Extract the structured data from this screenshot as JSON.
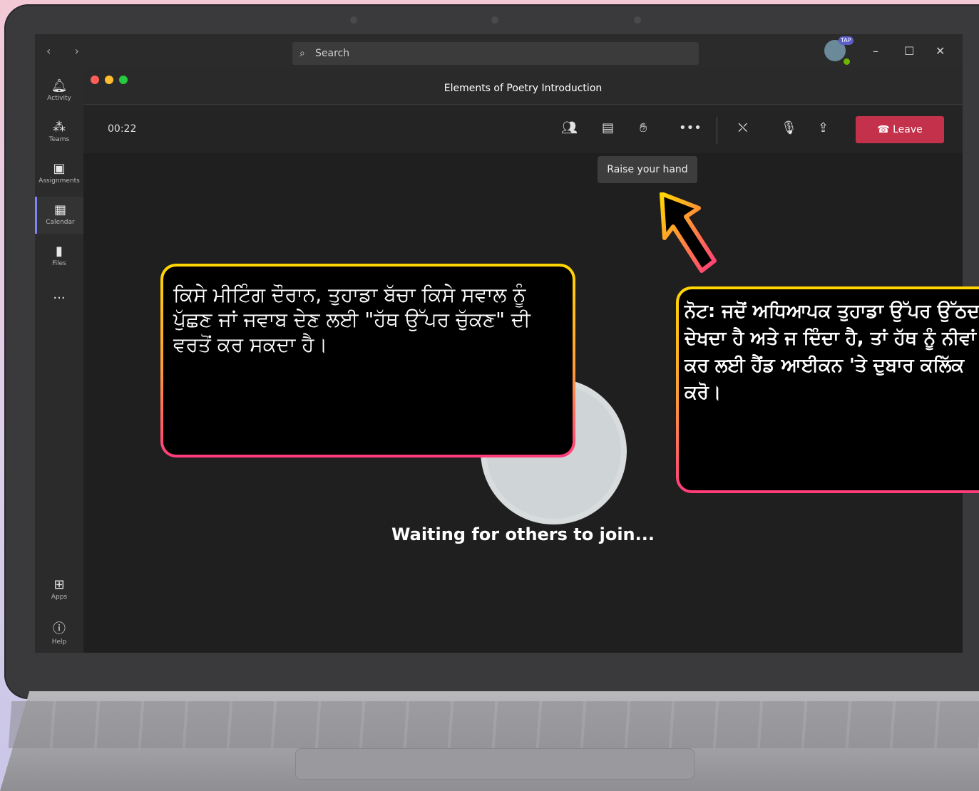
{
  "colors": {
    "accent": "#5b5fc7",
    "leave": "#c4314b",
    "callout_border_top": "#ffd700",
    "callout_border_bottom": "#ff3b7b"
  },
  "topbar": {
    "search_placeholder": "Search",
    "avatar_badge": "TAP"
  },
  "rail": {
    "items": [
      {
        "label": "Activity",
        "icon": "bell-icon"
      },
      {
        "label": "Teams",
        "icon": "teams-icon"
      },
      {
        "label": "Assignments",
        "icon": "assignments-icon"
      },
      {
        "label": "Calendar",
        "icon": "calendar-icon"
      },
      {
        "label": "Files",
        "icon": "files-icon"
      },
      {
        "label": "",
        "icon": "more-icon"
      },
      {
        "label": "Apps",
        "icon": "apps-icon"
      },
      {
        "label": "Help",
        "icon": "help-icon"
      }
    ]
  },
  "meeting": {
    "title": "Elements of Poetry Introduction",
    "timer": "00:22",
    "leave_label": "Leave",
    "tooltip": "Raise your hand",
    "waiting": "Waiting for others to join..."
  },
  "callouts": {
    "left": "ਕਿਸੇ ਮੀਟਿੰਗ ਦੌਰਾਨ, ਤੁਹਾਡਾ ਬੱਚਾ ਕਿਸੇ ਸਵਾਲ ਨੂੰ ਪੁੱਛਣ ਜਾਂ ਜਵਾਬ ਦੇਣ ਲਈ \"ਹੱਥ ਉੱਪਰ ਚੁੱਕਣ\" ਦੀ ਵਰਤੋਂ ਕਰ ਸਕਦਾ ਹੈ।",
    "right": "ਨੋਟ: ਜਦੋਂ ਅਧਿਆਪਕ ਤੁਹਾਡਾ ਉੱਪਰ ਉੱਠਦਾ ਦੇਖਦਾ ਹੈ ਅਤੇ ਜ ਦਿੰਦਾ ਹੈ, ਤਾਂ ਹੱਥ ਨੂੰ ਨੀਵਾਂ ਕਰ ਲਈ ਹੈਂਡ ਆਈਕਨ 'ਤੇ ਦੁਬਾਰ ਕਲਿੱਕ ਕਰੋ।"
  }
}
